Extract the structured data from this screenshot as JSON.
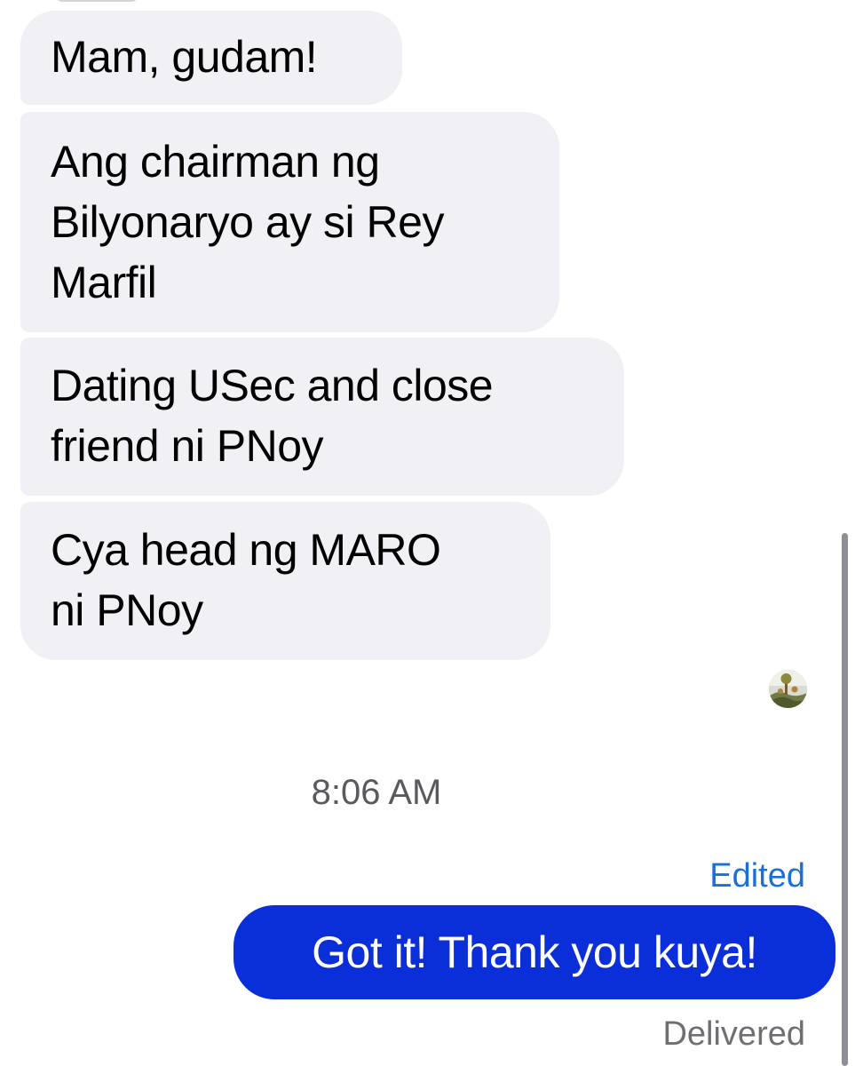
{
  "conversation": {
    "incoming_messages": [
      {
        "text": "Mam, gudam!"
      },
      {
        "text": "Ang chairman ng\nBilyonaryo ay si Rey\nMarfil"
      },
      {
        "text": "Dating USec and close\nfriend ni PNoy"
      },
      {
        "text": "Cya head ng MARO\nni PNoy"
      }
    ],
    "timestamp": "8:06 AM",
    "outgoing_message": {
      "edited_label": "Edited",
      "text": "Got it! Thank you kuya!",
      "status": "Delivered"
    }
  },
  "colors": {
    "incoming_bubble": "#f0f0f5",
    "outgoing_bubble": "#0a2fd8",
    "edited_label": "#1a6fd8",
    "secondary_text": "#6e6e73"
  },
  "icons": {
    "read_receipt": "read-receipt-avatar"
  }
}
